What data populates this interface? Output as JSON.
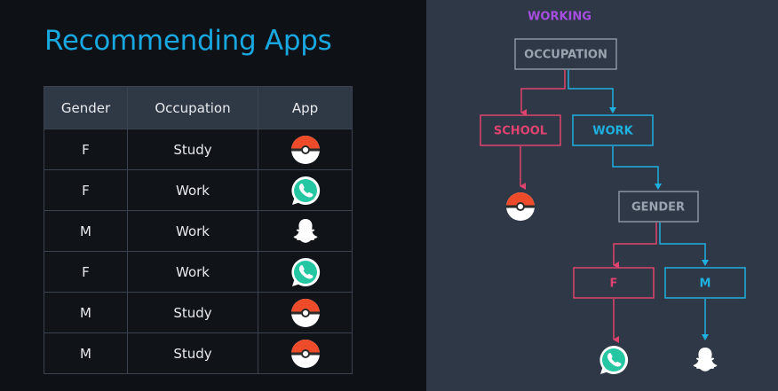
{
  "slide": {
    "title": "Recommending Apps"
  },
  "table": {
    "headers": [
      "Gender",
      "Occupation",
      "App"
    ],
    "rows": [
      {
        "gender": "F",
        "occupation": "Study",
        "app": "pokeball-icon"
      },
      {
        "gender": "F",
        "occupation": "Work",
        "app": "whatsapp-icon"
      },
      {
        "gender": "M",
        "occupation": "Work",
        "app": "snapchat-icon"
      },
      {
        "gender": "F",
        "occupation": "Work",
        "app": "whatsapp-icon"
      },
      {
        "gender": "M",
        "occupation": "Study",
        "app": "pokeball-icon"
      },
      {
        "gender": "M",
        "occupation": "Study",
        "app": "pokeball-icon"
      }
    ]
  },
  "tree": {
    "heading": "WORKING",
    "root": "OCCUPATION",
    "left_branch": "SCHOOL",
    "right_branch": "WORK",
    "sub_node": "GENDER",
    "sub_left": "F",
    "sub_right": "M"
  },
  "colors": {
    "title": "#19a7e0",
    "pink": "#e0436f",
    "blue": "#1fb0e0",
    "gray": "#8a95a3",
    "purple": "#a64ee0"
  }
}
